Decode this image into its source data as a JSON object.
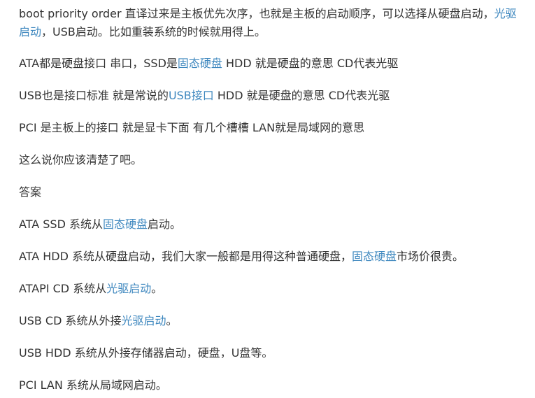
{
  "paragraphs": [
    {
      "segments": [
        {
          "text": "boot priority order 直译过来是主板优先次序，也就是主板的启动顺序，可以选择从硬盘启动，"
        },
        {
          "text": "光驱启动",
          "link": true
        },
        {
          "text": "，USB启动。比如重装系统的时候就用得上。"
        }
      ]
    },
    {
      "segments": [
        {
          "text": "ATA都是硬盘接口 串口，SSD是"
        },
        {
          "text": "固态硬盘",
          "link": true
        },
        {
          "text": " HDD 就是硬盘的意思 CD代表光驱"
        }
      ]
    },
    {
      "segments": [
        {
          "text": "USB也是接口标准 就是常说的"
        },
        {
          "text": "USB接口",
          "link": true
        },
        {
          "text": " HDD 就是硬盘的意思 CD代表光驱"
        }
      ]
    },
    {
      "segments": [
        {
          "text": "PCI 是主板上的接口 就是显卡下面 有几个槽槽 LAN就是局域网的意思"
        }
      ]
    },
    {
      "segments": [
        {
          "text": "这么说你应该清楚了吧。"
        }
      ]
    },
    {
      "segments": [
        {
          "text": "答案"
        }
      ]
    },
    {
      "segments": [
        {
          "text": "ATA SSD 系统从"
        },
        {
          "text": "固态硬盘",
          "link": true
        },
        {
          "text": "启动。"
        }
      ]
    },
    {
      "segments": [
        {
          "text": "ATA HDD 系统从硬盘启动，我们大家一般都是用得这种普通硬盘，"
        },
        {
          "text": "固态硬盘",
          "link": true
        },
        {
          "text": "市场价很贵。"
        }
      ]
    },
    {
      "segments": [
        {
          "text": "ATAPI CD 系统从"
        },
        {
          "text": "光驱启动",
          "link": true
        },
        {
          "text": "。"
        }
      ]
    },
    {
      "segments": [
        {
          "text": "USB CD 系统从外接"
        },
        {
          "text": "光驱启动",
          "link": true
        },
        {
          "text": "。"
        }
      ]
    },
    {
      "segments": [
        {
          "text": "USB HDD 系统从外接存储器启动，硬盘，U盘等。"
        }
      ]
    },
    {
      "segments": [
        {
          "text": "PCI LAN 系统从局域网启动。"
        }
      ]
    }
  ],
  "colors": {
    "text": "#333333",
    "link": "#3f88bf",
    "background": "#ffffff"
  }
}
